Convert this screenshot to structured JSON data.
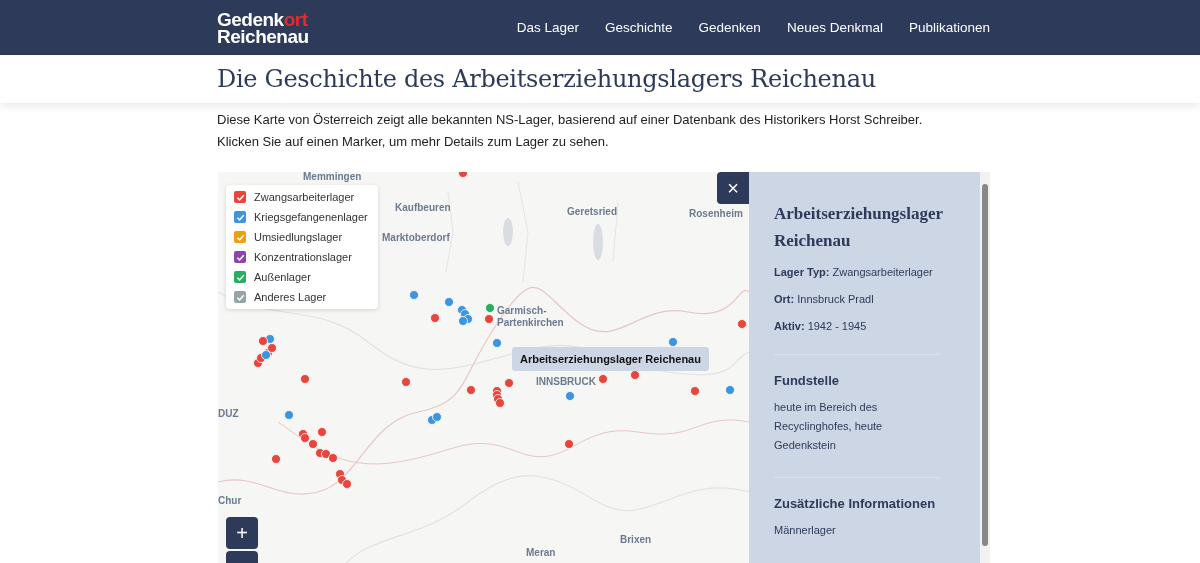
{
  "header": {
    "logo": {
      "part_1": "Gedenk",
      "part_2": "ort",
      "line_2": "Reichenau"
    },
    "nav": [
      "Das Lager",
      "Geschichte",
      "Gedenken",
      "Neues Denkmal",
      "Publikationen"
    ]
  },
  "page": {
    "title": "Die Geschichte des Arbeitserziehungslagers Reichenau",
    "intro": [
      "Diese Karte von Österreich zeigt alle bekannten NS-Lager, basierend auf einer Datenbank des Historikers Horst Schreiber.",
      "Klicken Sie auf einen Marker, um mehr Details zum Lager zu sehen."
    ]
  },
  "map": {
    "legend": [
      {
        "label": "Zwangsarbeiterlager",
        "checked": true,
        "color": "#e8453c"
      },
      {
        "label": "Kriegsgefangenenlager",
        "checked": true,
        "color": "#3b95e0"
      },
      {
        "label": "Umsiedlungslager",
        "checked": true,
        "color": "#f39c12"
      },
      {
        "label": "Konzentrationslager",
        "checked": true,
        "color": "#8e44ad"
      },
      {
        "label": "Außenlager",
        "checked": true,
        "color": "#27ae60"
      },
      {
        "label": "Anderes Lager",
        "checked": true,
        "color": "#95a5a6"
      }
    ],
    "cities": [
      "Memmingen",
      "Kaufbeuren",
      "Geretsried",
      "Rosenheim",
      "Marktoberdorf",
      "Garmisch-\nPartenkirchen",
      "INNSBRUCK",
      "DUZ",
      "Chur",
      "Meran",
      "Brixen"
    ],
    "tooltip": "Arbeitserziehungslager Reichenau",
    "close": "×",
    "zoom_in": "+"
  },
  "panel": {
    "title": "Arbeitserziehungslager Reichenau",
    "facts": [
      {
        "label": "Lager Typ:",
        "value": "Zwangsarbeiterlager"
      },
      {
        "label": "Ort:",
        "value": "Innsbruck Pradl"
      },
      {
        "label": "Aktiv:",
        "value": "1942 - 1945"
      }
    ],
    "sections": [
      {
        "heading": "Fundstelle",
        "text": "heute im Bereich des Recyclinghofes, heute Gedenkstein"
      },
      {
        "heading": "Zusätzliche Informationen",
        "text": "Männerlager"
      }
    ]
  }
}
